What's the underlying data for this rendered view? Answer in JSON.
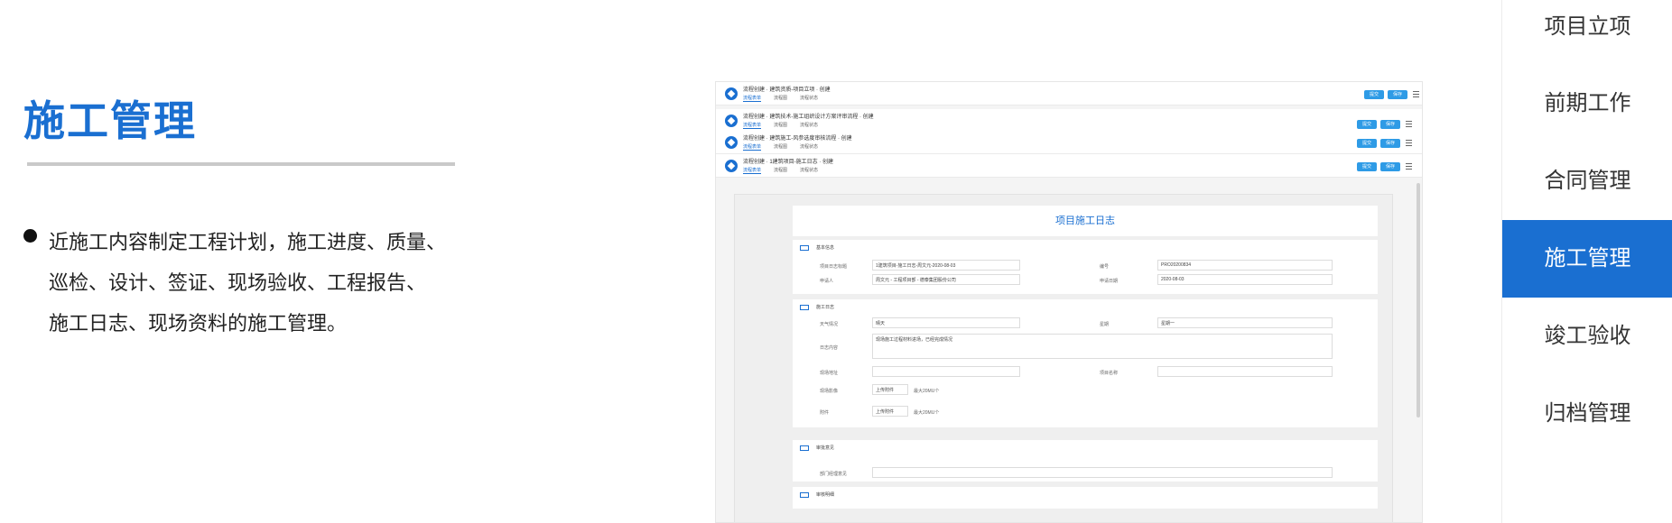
{
  "section": {
    "title": "施工管理",
    "bullet_lines": [
      "近施工内容制定工程计划，施工进度、质量、",
      "巡检、设计、签证、现场验收、工程报告、",
      "施工日志、现场资料的施工管理。"
    ]
  },
  "screenshot": {
    "tabs": [
      {
        "title": "流程创建 · 建筑资质-项目立项 · 创建",
        "subs": [
          "流程表单",
          "流程图",
          "流程状态"
        ]
      },
      {
        "title": "流程创建 · 建筑技术-施工组织设计方案评审流程 · 创建",
        "subs": [
          "流程表单",
          "流程图",
          "流程状态"
        ]
      },
      {
        "title": "流程创建 · 建筑施工-风参选度审核流程 · 创建",
        "subs": [
          "流程表单",
          "流程图",
          "流程状态"
        ]
      },
      {
        "title": "流程创建 · 1建筑项目-施工日志 · 创建",
        "subs": [
          "流程表单",
          "流程图",
          "流程状态"
        ]
      }
    ],
    "btn_submit": "提交",
    "btn_save": "保存",
    "form_title": "项目施工日志",
    "basic": {
      "header": "基本信息",
      "subject_label": "项目日志标题",
      "subject_value": "1建筑项目-施工日志-周文元-2020-08-03",
      "no_label": "编号",
      "no_value": "PRO20200834",
      "applicant_label": "申请人",
      "applicant_value": "周文元 - 工程项目部 - 德泰集团股份公司",
      "date_label": "申请日期",
      "date_value": "2020-08-03"
    },
    "log": {
      "header": "施工日志",
      "weather_label": "天气情况",
      "weather_value": "晴天",
      "week_label": "星期",
      "week_value": "星期一",
      "content_label": "日志内容",
      "content_value": "现场施工过程材料进场，已经完成情况",
      "site_label": "现场地址",
      "project_label": "项目名称",
      "photo_label": "现场影像",
      "attach_label": "附件",
      "upload_label": "上传附件",
      "upload_hint": "最大20MU个"
    },
    "approval": {
      "header": "审批意见",
      "dept_label": "部门经理意见"
    },
    "detail": {
      "header": "审核明细"
    }
  },
  "nav": {
    "items": [
      "项目立项",
      "前期工作",
      "合同管理",
      "施工管理",
      "竣工验收",
      "归档管理"
    ],
    "active_index": 3
  },
  "colors": {
    "accent": "#1a6fd1",
    "button": "#2e9be6"
  }
}
